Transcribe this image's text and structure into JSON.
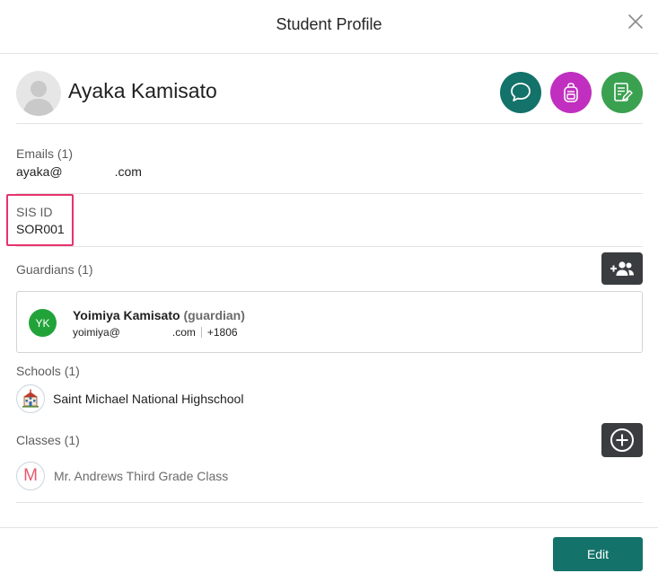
{
  "dialog": {
    "title": "Student Profile",
    "close_icon": "close-icon"
  },
  "student": {
    "name": "Ayaka Kamisato",
    "avatar_icon": "person-silhouette-icon"
  },
  "actions": {
    "message_icon": "chat-bubble-icon",
    "backpack_icon": "backpack-icon",
    "notes_icon": "notes-edit-icon",
    "message_color": "#137269",
    "backpack_color": "#c02fbf",
    "notes_color": "#3aa150"
  },
  "emails": {
    "label": "Emails (1)",
    "value_prefix": "ayaka@",
    "value_suffix": ".com"
  },
  "sis": {
    "label": "SIS ID",
    "value": "SOR001",
    "highlight_color": "#e8336c"
  },
  "guardians": {
    "label": "Guardians (1)",
    "add_icon": "add-user-icon",
    "items": [
      {
        "initials": "YK",
        "name": "Yoimiya Kamisato",
        "role": "(guardian)",
        "email_prefix": "yoimiya@",
        "email_suffix": ".com",
        "phone": "+1806"
      }
    ]
  },
  "schools": {
    "label": "Schools (1)",
    "items": [
      {
        "name": "Saint Michael National Highschool",
        "icon": "school-building-icon"
      }
    ]
  },
  "classes": {
    "label": "Classes (1)",
    "add_icon": "plus-circle-icon",
    "items": [
      {
        "initial": "M",
        "name": "Mr. Andrews Third Grade Class"
      }
    ]
  },
  "footer": {
    "edit_label": "Edit"
  }
}
